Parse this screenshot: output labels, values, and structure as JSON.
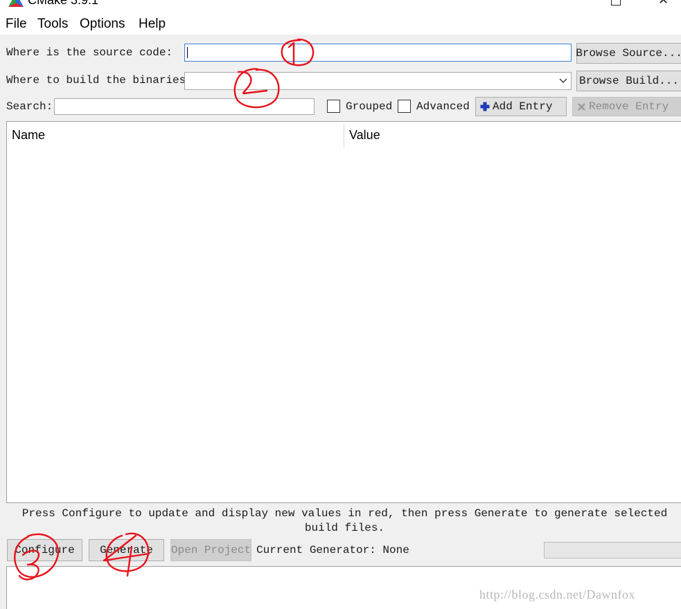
{
  "window": {
    "title": "CMake 3.9.1"
  },
  "menu": {
    "items": [
      "File",
      "Tools",
      "Options",
      "Help"
    ]
  },
  "source": {
    "label": "Where is the source code:",
    "value": "",
    "browse_label": "Browse Source..."
  },
  "build": {
    "label": "Where to build the binaries:",
    "value": "",
    "browse_label": "Browse Build..."
  },
  "search": {
    "label": "Search:",
    "value": "",
    "grouped_label": "Grouped",
    "grouped_checked": false,
    "advanced_label": "Advanced",
    "advanced_checked": false,
    "add_entry_label": "Add Entry",
    "remove_entry_label": "Remove Entry"
  },
  "table": {
    "columns": [
      "Name",
      "Value"
    ],
    "rows": []
  },
  "hint_text": "Press Configure to update and display new values in red, then press Generate to generate selected build files.",
  "actions": {
    "configure_label": "Configure",
    "generate_label": "Generate",
    "open_project_label": "Open Project",
    "current_generator_text": "Current Generator: None"
  },
  "progress": 0,
  "output_text": "",
  "watermark": "http://blog.csdn.net/Dawnfox",
  "annotations": [
    "1",
    "2",
    "3",
    "4"
  ],
  "colors": {
    "annotation_red": "#e8101a",
    "focus_blue": "#3c7fd6",
    "add_icon_blue": "#1f3fd0"
  }
}
